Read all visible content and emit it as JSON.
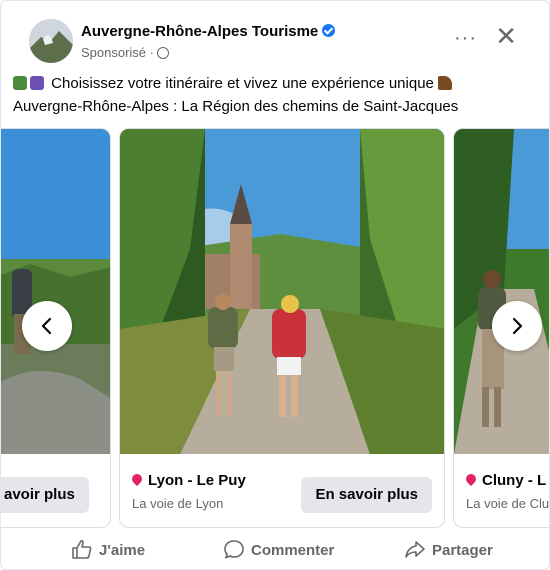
{
  "post": {
    "page_name": "Auvergne-Rhône-Alpes Tourisme",
    "sponsored": "Sponsorisé ·",
    "line1": "Choisissez votre itinéraire et vivez une expérience unique",
    "line2": "Auvergne-Rhône-Alpes : La Région des chemins de Saint-Jacques"
  },
  "header": {
    "more_label": "···",
    "close_label": "✕"
  },
  "carousel": {
    "left_slide": {
      "cta": "avoir plus"
    },
    "center_slide": {
      "title": "Lyon - Le Puy",
      "subtitle": "La voie de Lyon",
      "cta": "En savoir plus"
    },
    "right_slide": {
      "title": "Cluny - L",
      "subtitle": "La voie de Clu"
    }
  },
  "actions": {
    "like": "J'aime",
    "comment": "Commenter",
    "share": "Partager"
  },
  "icons": {
    "verified": "verified-badge-icon",
    "globe": "globe-icon",
    "pin": "location-pin-icon",
    "prev": "chevron-left-icon",
    "next": "chevron-right-icon",
    "like": "thumbs-up-icon",
    "comment": "comment-bubble-icon",
    "share": "share-arrow-icon"
  },
  "colors": {
    "verified": "#1877f2",
    "text_muted": "#65676b",
    "button_bg": "#e4e6eb",
    "pin": "#e0245e"
  }
}
